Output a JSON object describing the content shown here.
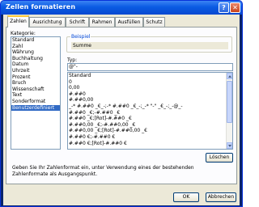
{
  "window": {
    "title": "Zellen formatieren",
    "help_glyph": "?",
    "close_glyph": "✕"
  },
  "tabs": [
    {
      "label": "Zahlen",
      "active": true
    },
    {
      "label": "Ausrichtung",
      "active": false
    },
    {
      "label": "Schrift",
      "active": false
    },
    {
      "label": "Rahmen",
      "active": false
    },
    {
      "label": "Ausfüllen",
      "active": false
    },
    {
      "label": "Schutz",
      "active": false
    }
  ],
  "category": {
    "label": "Kategorie:",
    "items": [
      "Standard",
      "Zahl",
      "Währung",
      "Buchhaltung",
      "Datum",
      "Uhrzeit",
      "Prozent",
      "Bruch",
      "Wissenschaft",
      "Text",
      "Sonderformat",
      "Benutzerdefiniert"
    ],
    "selected_index": 11
  },
  "sample": {
    "label": "Beispiel",
    "value": "Summe"
  },
  "type": {
    "label": "Typ:",
    "value": "@\"-",
    "items": [
      "Standard",
      "0",
      "0,00",
      "#.##0",
      "#.##0,00",
      "_-* #.##0 _€_-;-* #.##0 _€_-;_-* \"-\" _€_-;_-@_-",
      "#.##0 _€;-#.##0 _€",
      "#.##0 _€;[Rot]-#.##0 _€",
      "#.##0,00 _€;-#.##0,00 _€",
      "#.##0,00 _€;[Rot]-#.##0,00 _€",
      "#.##0 €;-#.##0 €",
      "#.##0 €;[Rot]-#.##0 €"
    ]
  },
  "buttons": {
    "delete": "Löschen",
    "ok": "OK",
    "cancel": "Abbrechen"
  },
  "description": "Geben Sie Ihr Zahlenformat ein, unter Verwendung eines der bestehenden Zahlenformate als Ausgangspunkt.",
  "colors": {
    "title_bar": "#0a5be3",
    "selection": "#316ac5",
    "group_title": "#0046d5",
    "active_tab": "#ffc83c"
  }
}
